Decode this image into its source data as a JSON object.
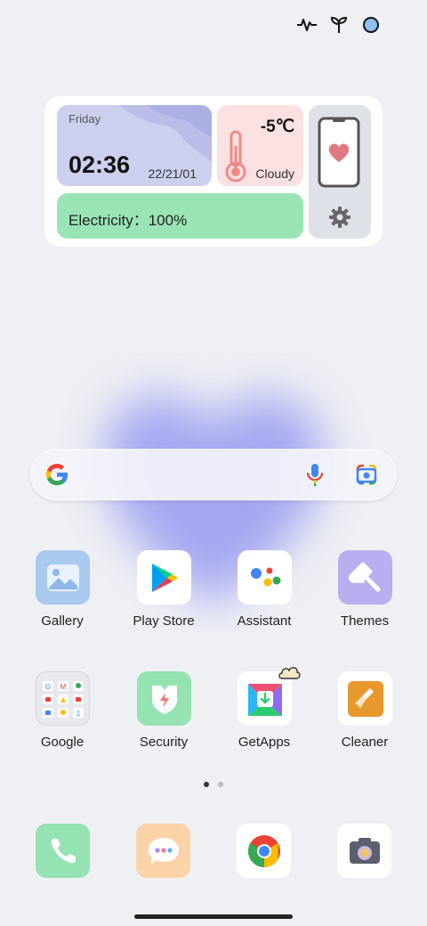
{
  "status_bar": {
    "icons": [
      "activity-icon",
      "sprout-icon",
      "blue-dot-icon"
    ]
  },
  "widget": {
    "day": "Friday",
    "time": "02:36",
    "date": "22/21/01",
    "temperature": "-5℃",
    "condition": "Cloudy",
    "battery": "Electricity：100%"
  },
  "search": {
    "icons": [
      "google-icon",
      "mic-icon",
      "lens-icon"
    ]
  },
  "apps": [
    {
      "label": "Gallery"
    },
    {
      "label": "Play Store"
    },
    {
      "label": "Assistant"
    },
    {
      "label": "Themes"
    },
    {
      "label": "Google"
    },
    {
      "label": "Security"
    },
    {
      "label": "GetApps"
    },
    {
      "label": "Cleaner"
    }
  ],
  "dock": [
    "phone-icon",
    "messages-icon",
    "chrome-icon",
    "camera-icon"
  ],
  "pager": {
    "pages": 2,
    "current": 1
  },
  "colors": {
    "background": "#eff0f4",
    "heart": "#8b8ff0",
    "clock_card": "#ccd0ee",
    "weather_card": "#fbe1e1",
    "battery_card": "#99e4b4",
    "phone_card": "#dfe1e8",
    "gallery": "#a9c9ee",
    "themes": "#b8aff0",
    "security": "#95e2b3",
    "phone": "#95e2b3",
    "messages": "#fbd3a7",
    "cleaner": "#e8982c"
  }
}
